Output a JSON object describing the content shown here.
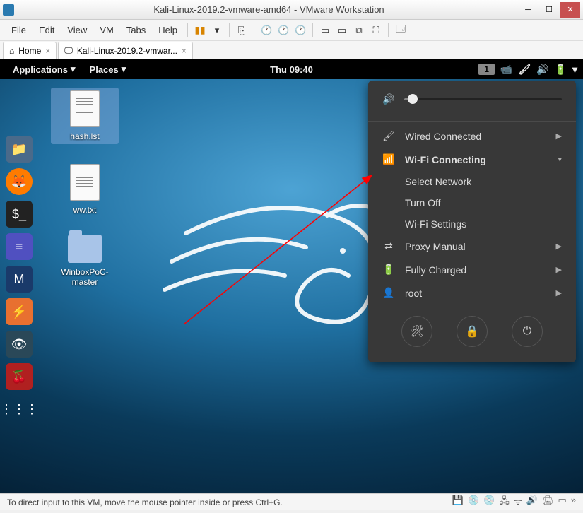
{
  "vmware": {
    "title": "Kali-Linux-2019.2-vmware-amd64 - VMware Workstation",
    "menu": [
      "File",
      "Edit",
      "View",
      "VM",
      "Tabs",
      "Help"
    ],
    "tabs": {
      "home": "Home",
      "vm": "Kali-Linux-2019.2-vmwar..."
    },
    "status": "To direct input to this VM, move the mouse pointer inside or press Ctrl+G."
  },
  "gnome": {
    "applications": "Applications",
    "places": "Places",
    "clock": "Thu 09:40",
    "workspace": "1"
  },
  "desktop_icons": [
    {
      "label": "hash.lst",
      "type": "file",
      "selected": true
    },
    {
      "label": "ww.txt",
      "type": "file",
      "selected": false
    },
    {
      "label": "WinboxPoC-master",
      "type": "folder",
      "selected": false
    }
  ],
  "system_menu": {
    "volume_percent": 5,
    "wired": {
      "label": "Wired Connected",
      "icon": "brush"
    },
    "wifi": {
      "label": "Wi-Fi Connecting",
      "expanded": true,
      "items": [
        "Select Network",
        "Turn Off",
        "Wi-Fi Settings"
      ]
    },
    "proxy": {
      "label": "Proxy Manual"
    },
    "battery": {
      "label": "Fully Charged"
    },
    "user": {
      "label": "root"
    },
    "actions": {
      "settings": "settings",
      "lock": "lock",
      "power": "power"
    }
  }
}
